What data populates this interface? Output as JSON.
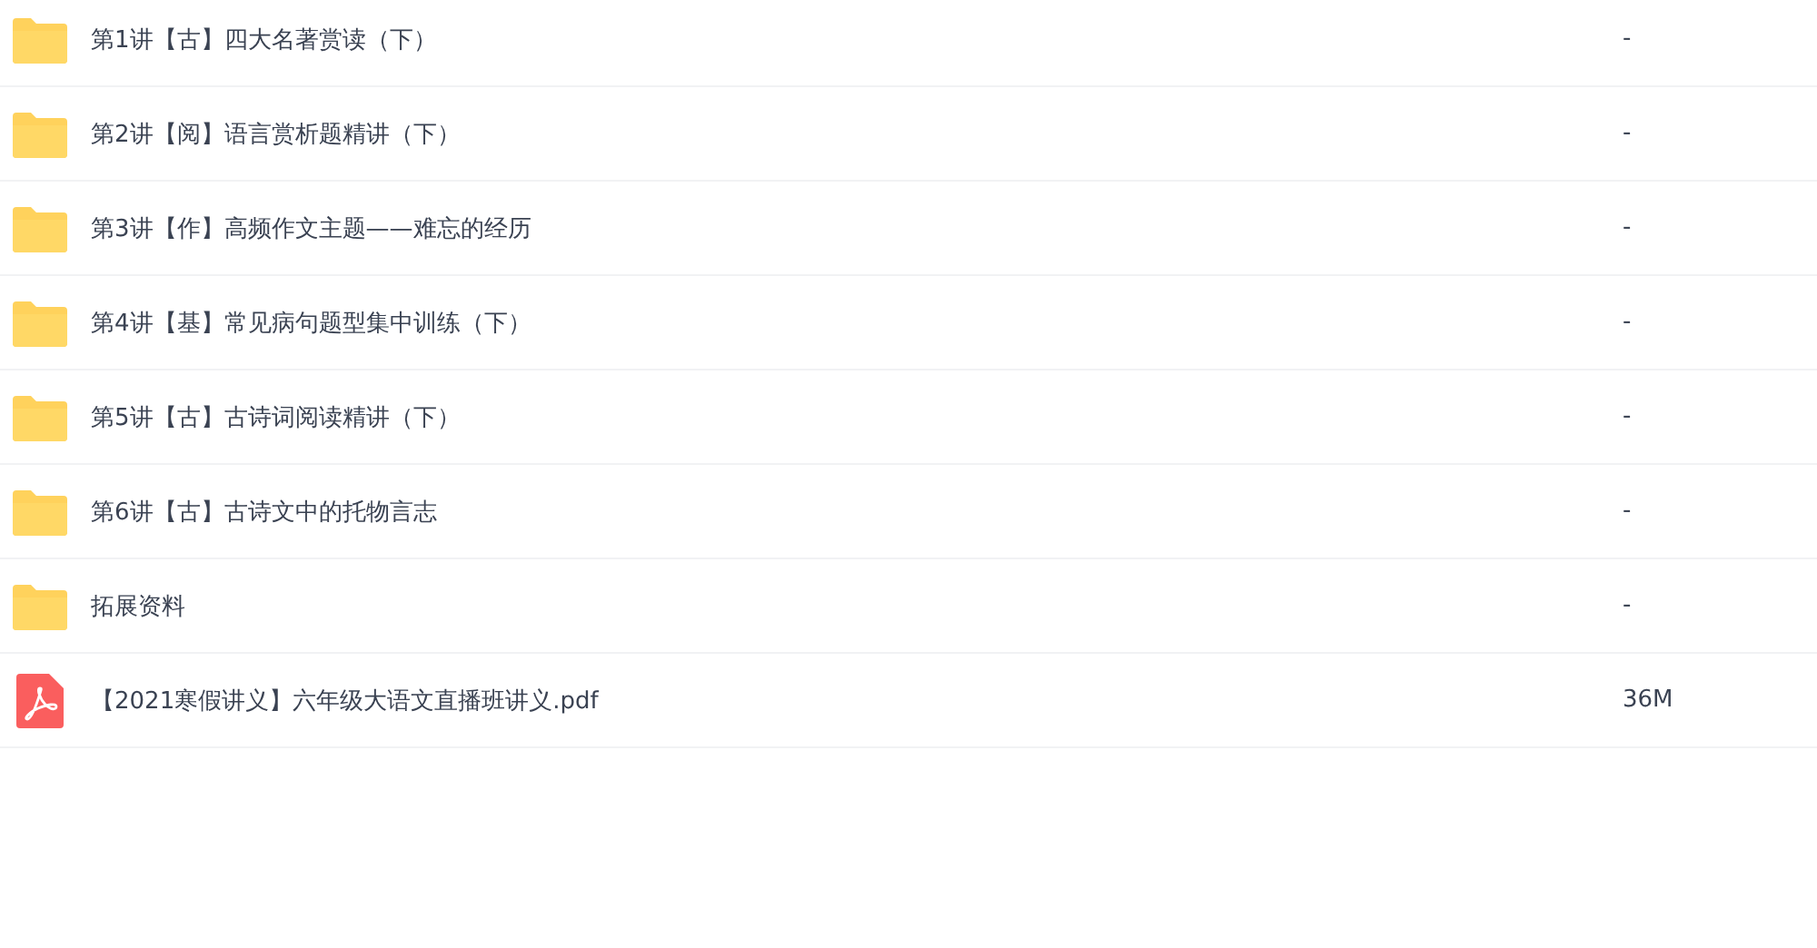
{
  "files": [
    {
      "kind": "folder",
      "name": "第1讲【古】四大名著赏读（下）",
      "size": "-"
    },
    {
      "kind": "folder",
      "name": "第2讲【阅】语言赏析题精讲（下）",
      "size": "-"
    },
    {
      "kind": "folder",
      "name": "第3讲【作】高频作文主题——难忘的经历",
      "size": "-"
    },
    {
      "kind": "folder",
      "name": "第4讲【基】常见病句题型集中训练（下）",
      "size": "-"
    },
    {
      "kind": "folder",
      "name": "第5讲【古】古诗词阅读精讲（下）",
      "size": "-"
    },
    {
      "kind": "folder",
      "name": "第6讲【古】古诗文中的托物言志",
      "size": "-"
    },
    {
      "kind": "folder",
      "name": "拓展资料",
      "size": "-"
    },
    {
      "kind": "pdf",
      "name": "【2021寒假讲义】六年级大语文直播班讲义.pdf",
      "size": "36M"
    }
  ]
}
